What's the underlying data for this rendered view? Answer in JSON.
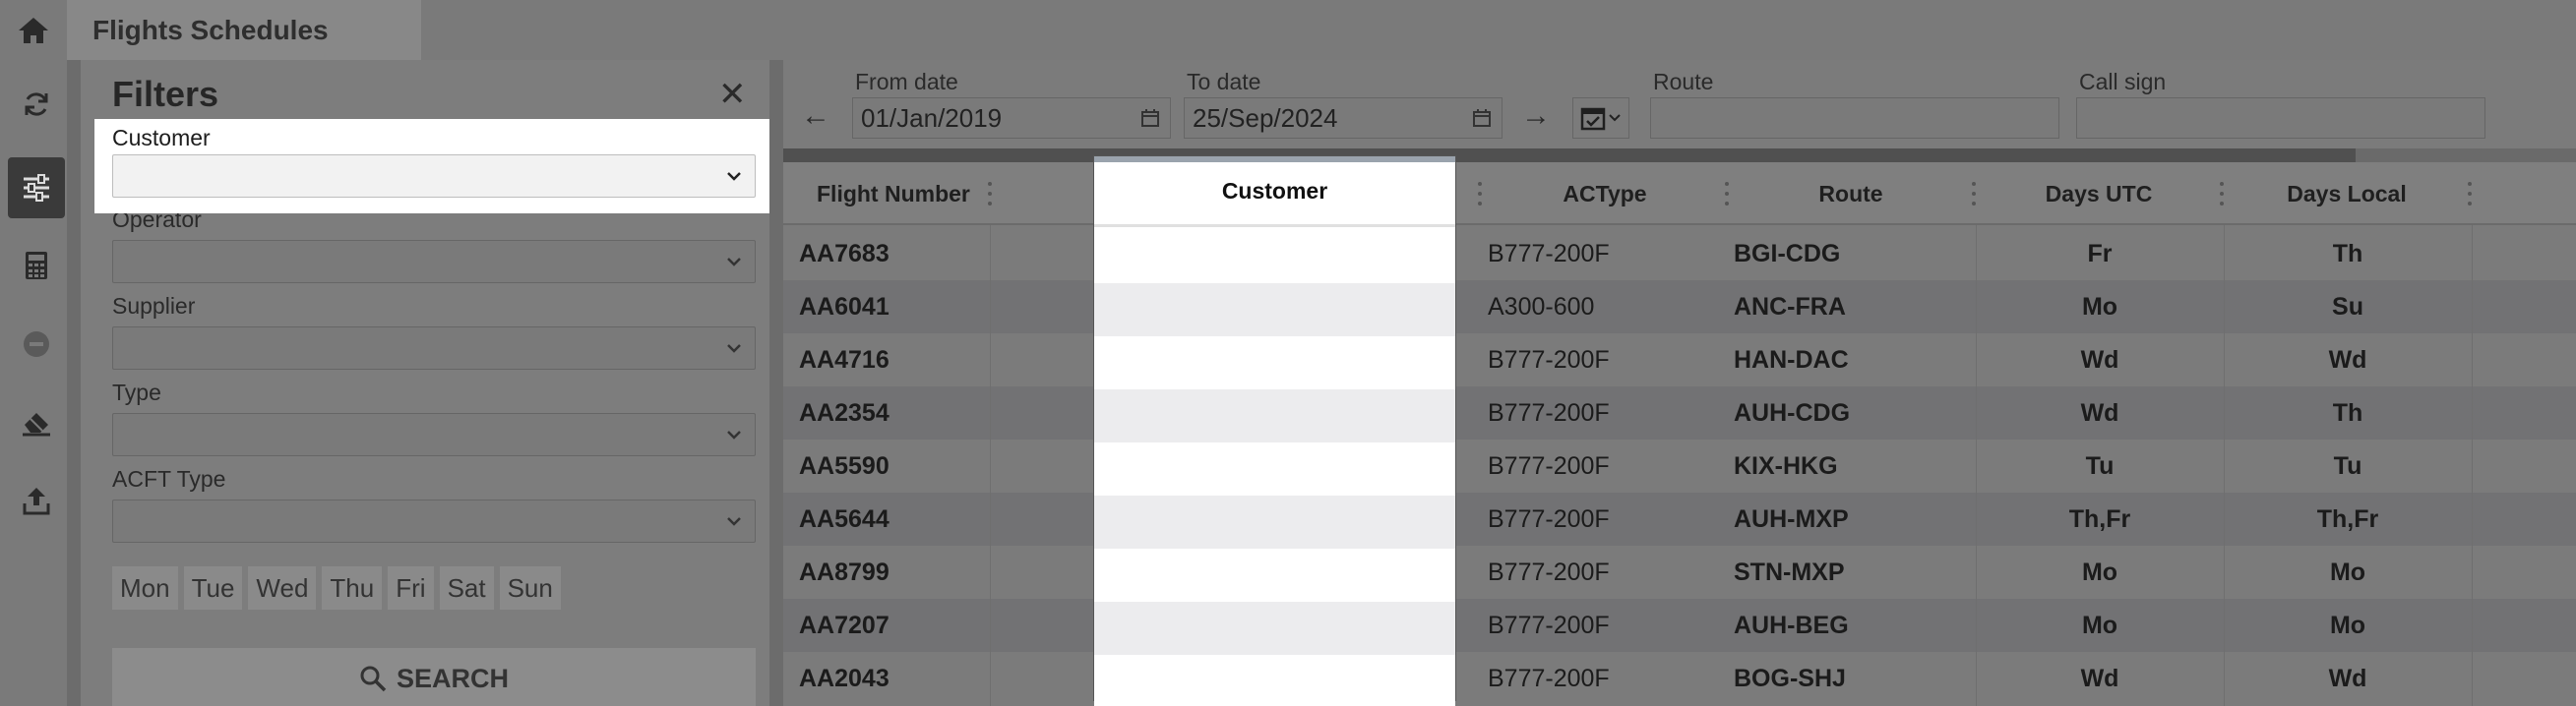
{
  "app": {
    "title": "Flights Schedules"
  },
  "rail": {
    "icons": [
      "home-icon",
      "refresh-icon",
      "sliders-icon",
      "calculator-icon",
      "minus-circle-icon",
      "eraser-icon",
      "upload-icon"
    ]
  },
  "filters": {
    "title": "Filters",
    "close_glyph": "✕",
    "customer": {
      "label": "Customer",
      "value": ""
    },
    "operator": {
      "label": "Operator",
      "value": ""
    },
    "supplier": {
      "label": "Supplier",
      "value": ""
    },
    "type": {
      "label": "Type",
      "value": ""
    },
    "acft_type": {
      "label": "ACFT Type",
      "value": ""
    },
    "days": [
      "Mon",
      "Tue",
      "Wed",
      "Thu",
      "Fri",
      "Sat",
      "Sun"
    ],
    "search_label": "SEARCH"
  },
  "toolbar": {
    "prev_glyph": "←",
    "next_glyph": "→",
    "from_label": "From date",
    "from_value": "01/Jan/2019",
    "to_label": "To date",
    "to_value": "25/Sep/2024",
    "route_label": "Route",
    "route_value": "",
    "callsign_label": "Call sign",
    "callsign_value": ""
  },
  "grid": {
    "columns": [
      "Flight Number",
      "Customer",
      "ACType",
      "Route",
      "Days UTC",
      "Days Local"
    ],
    "rows": [
      {
        "flight": "AA7683",
        "customer": "",
        "actype": "B777-200F",
        "route": "BGI-CDG",
        "days_utc": "Fr",
        "days_local": "Th"
      },
      {
        "flight": "AA6041",
        "customer": "",
        "actype": "A300-600",
        "route": "ANC-FRA",
        "days_utc": "Mo",
        "days_local": "Su"
      },
      {
        "flight": "AA4716",
        "customer": "",
        "actype": "B777-200F",
        "route": "HAN-DAC",
        "days_utc": "Wd",
        "days_local": "Wd"
      },
      {
        "flight": "AA2354",
        "customer": "",
        "actype": "B777-200F",
        "route": "AUH-CDG",
        "days_utc": "Wd",
        "days_local": "Th"
      },
      {
        "flight": "AA5590",
        "customer": "",
        "actype": "B777-200F",
        "route": "KIX-HKG",
        "days_utc": "Tu",
        "days_local": "Tu"
      },
      {
        "flight": "AA5644",
        "customer": "",
        "actype": "B777-200F",
        "route": "AUH-MXP",
        "days_utc": "Th,Fr",
        "days_local": "Th,Fr"
      },
      {
        "flight": "AA8799",
        "customer": "",
        "actype": "B777-200F",
        "route": "STN-MXP",
        "days_utc": "Mo",
        "days_local": "Mo"
      },
      {
        "flight": "AA7207",
        "customer": "",
        "actype": "B777-200F",
        "route": "AUH-BEG",
        "days_utc": "Mo",
        "days_local": "Mo"
      },
      {
        "flight": "AA2043",
        "customer": "",
        "actype": "B777-200F",
        "route": "BOG-SHJ",
        "days_utc": "Wd",
        "days_local": "Wd"
      }
    ]
  }
}
